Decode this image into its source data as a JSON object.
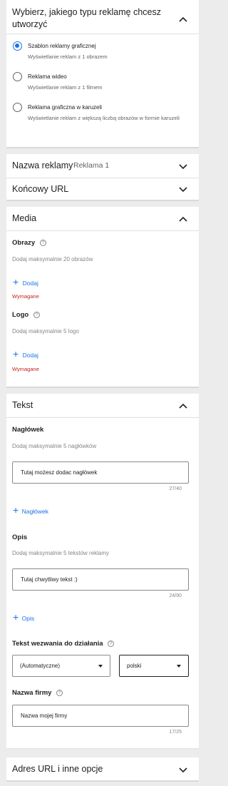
{
  "ad_type": {
    "title": "Wybierz, jakiego typu reklamę chcesz utworzyć",
    "options": [
      {
        "label": "Szablon reklamy graficznej",
        "desc": "Wyświetlanie reklam z 1 obrazem",
        "selected": true
      },
      {
        "label": "Reklama wideo",
        "desc": "Wyświetlanie reklam z 1 filmem",
        "selected": false
      },
      {
        "label": "Reklama graficzna w karuzeli",
        "desc": "Wyświetlanie reklam z większą liczbą obrazów w formie karuzeli",
        "selected": false
      }
    ]
  },
  "ad_name": {
    "label": "Nazwa reklamy",
    "value": "Reklama 1"
  },
  "final_url": {
    "label": "Końcowy URL"
  },
  "media": {
    "title": "Media",
    "images": {
      "label": "Obrazy",
      "hint": "Dodaj maksymalnie 20 obrazów",
      "add": "Dodaj",
      "required": "Wymagane"
    },
    "logo": {
      "label": "Logo",
      "hint": "Dodaj maksymalnie 5 logo",
      "add": "Dodaj",
      "required": "Wymagane"
    }
  },
  "text": {
    "title": "Tekst",
    "headline": {
      "label": "Nagłówek",
      "hint": "Dodaj maksymalnie 5 nagłówków",
      "value": "Tutaj możesz dodac nagłówek",
      "count": "27/40",
      "add": "Nagłówek"
    },
    "description": {
      "label": "Opis",
      "hint": "Dodaj maksymalnie 5 tekstów reklamy",
      "value": "Tutaj chwytliwy tekst :)",
      "count": "24/90",
      "add": "Opis"
    },
    "cta": {
      "label": "Tekst wezwania do działania",
      "value": "(Automatyczne)",
      "language": "polski"
    },
    "business": {
      "label": "Nazwa firmy",
      "value": "Nazwa mojej firmy",
      "count": "17/25"
    }
  },
  "url_options": {
    "label": "Adres URL i inne opcje"
  },
  "colors": {
    "accent": "#1a73e8",
    "error": "#c5221f"
  }
}
